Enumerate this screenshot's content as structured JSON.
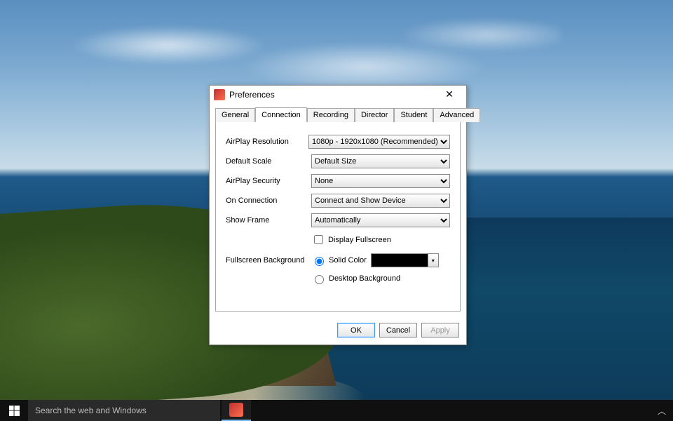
{
  "dialog": {
    "title": "Preferences",
    "tabs": [
      "General",
      "Connection",
      "Recording",
      "Director",
      "Student",
      "Advanced"
    ],
    "active_tab": "Connection",
    "rows": {
      "airplay_resolution": {
        "label": "AirPlay Resolution",
        "value": "1080p - 1920x1080 (Recommended)"
      },
      "default_scale": {
        "label": "Default Scale",
        "value": "Default Size"
      },
      "airplay_security": {
        "label": "AirPlay Security",
        "value": "None"
      },
      "on_connection": {
        "label": "On Connection",
        "value": "Connect and Show Device"
      },
      "show_frame": {
        "label": "Show Frame",
        "value": "Automatically"
      }
    },
    "display_fullscreen": {
      "label": "Display Fullscreen",
      "checked": false
    },
    "fullscreen_background": {
      "label": "Fullscreen Background",
      "option_solid": "Solid Color",
      "option_desktop": "Desktop Background",
      "selected": "solid",
      "solid_color": "#000000"
    },
    "buttons": {
      "ok": "OK",
      "cancel": "Cancel",
      "apply": "Apply"
    }
  },
  "taskbar": {
    "search_placeholder": "Search the web and Windows"
  }
}
